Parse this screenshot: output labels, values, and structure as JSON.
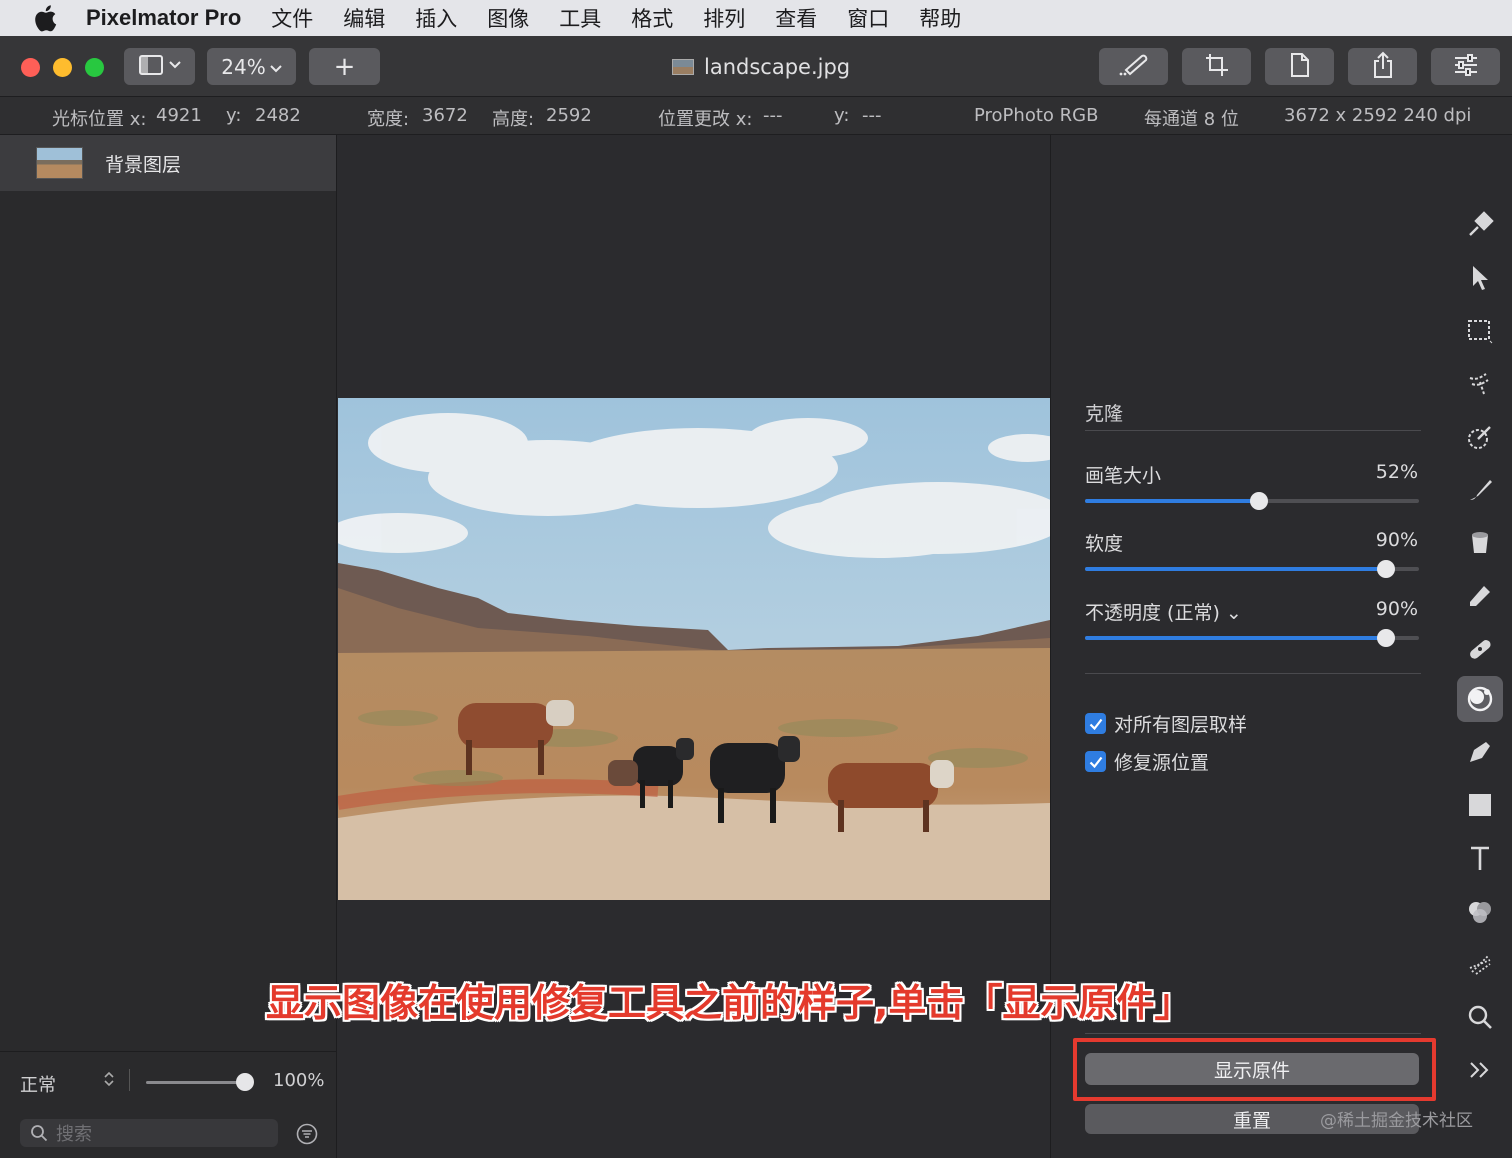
{
  "menubar": {
    "app_name": "Pixelmator Pro",
    "items": [
      "文件",
      "编辑",
      "插入",
      "图像",
      "工具",
      "格式",
      "排列",
      "查看",
      "窗口",
      "帮助"
    ]
  },
  "toolbar": {
    "zoom_label": "24%",
    "add_label": "+",
    "document_title": "landscape.jpg"
  },
  "infobar": {
    "cursor_x_label": "光标位置 x:",
    "cursor_x": "4921",
    "cursor_y_label": "y:",
    "cursor_y": "2482",
    "width_label": "宽度:",
    "width": "3672",
    "height_label": "高度:",
    "height": "2592",
    "pos_change_x_label": "位置更改 x:",
    "pos_change_x": "---",
    "pos_change_y_label": "y:",
    "pos_change_y": "---",
    "color_profile": "ProPhoto RGB",
    "bit_depth": "每通道 8 位",
    "dimensions_dpi": "3672 x 2592 240 dpi"
  },
  "layers": {
    "items": [
      {
        "name": "背景图层"
      }
    ],
    "blend_mode": "正常",
    "opacity_label": "100%",
    "search_placeholder": "搜索"
  },
  "clone_panel": {
    "title": "克隆",
    "brush_size_label": "画笔大小",
    "brush_size_value": "52%",
    "brush_size_fraction": 0.52,
    "softness_label": "软度",
    "softness_value": "90%",
    "softness_fraction": 0.9,
    "opacity_label": "不透明度 (正常) ⌄",
    "opacity_value": "90%",
    "opacity_fraction": 0.9,
    "sample_all_layers": "对所有图层取样",
    "fix_source_position": "修复源位置",
    "show_original": "显示原件",
    "reset": "重置"
  },
  "tools": [
    "style-tool",
    "arrange-tool",
    "selection-tool",
    "quick-selection-tool",
    "color-select-tool",
    "paint-tool",
    "bucket-tool",
    "erase-tool",
    "repair-tool",
    "clone-tool",
    "pen-tool",
    "shape-tool",
    "type-tool",
    "color-adjust-tool",
    "distort-tool",
    "zoom-tool",
    "more-tools"
  ],
  "annotation": {
    "caption": "显示图像在使用修复工具之前的样子,单击「显示原件」",
    "highlight_color": "#e53a2f"
  },
  "watermark": "@稀土掘金技术社区",
  "colors": {
    "accent": "#2f7de1",
    "close": "#fe5f57",
    "minimize": "#febc2e",
    "zoom": "#28c840"
  }
}
